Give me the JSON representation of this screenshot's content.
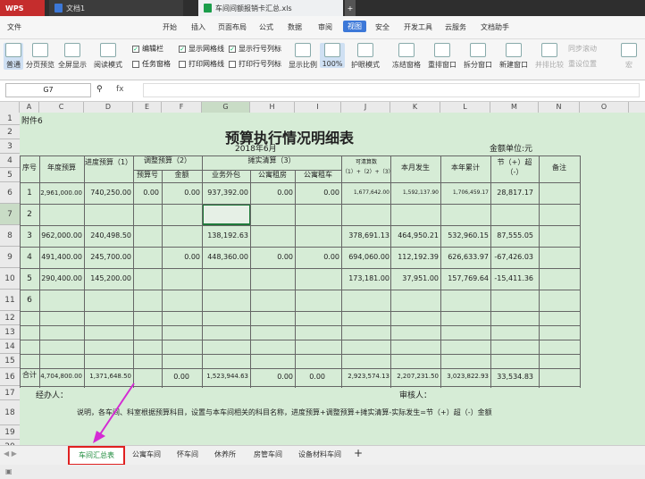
{
  "app": {
    "name": "WPS",
    "tab1": "文档1",
    "tab2": "车间间额报销卡汇总.xls",
    "add_tab": "+"
  },
  "menu": [
    "文件",
    "开始",
    "插入",
    "页面布局",
    "公式",
    "数据",
    "审阅",
    "视图",
    "安全",
    "开发工具",
    "云服务",
    "文档助手"
  ],
  "ribbon": {
    "normal": "普通",
    "page_break": "分页预览",
    "fullscreen": "全屏显示",
    "reading": "阅读模式",
    "edit_bar": "编辑栏",
    "show_grid": "显示网格线",
    "show_rowcol": "显示行号列标",
    "task_pane": "任务窗格",
    "print_grid": "打印网格线",
    "print_rowcol": "打印行号列标",
    "zoom": "显示比例",
    "zoom_value": "100%",
    "eye": "护眼模式",
    "freeze": "冻结窗格",
    "rearrange": "重排窗口",
    "split": "拆分窗口",
    "new_window": "新建窗口",
    "compare": "并排比较",
    "sync_scroll": "同步滚动",
    "reset_pos": "重设位置",
    "macro": "宏"
  },
  "formula": {
    "cell_ref": "G7",
    "fx": "fx",
    "content": ""
  },
  "columns": [
    "A",
    "C",
    "D",
    "E",
    "F",
    "G",
    "H",
    "I",
    "J",
    "K",
    "L",
    "M",
    "N",
    "O"
  ],
  "rows": [
    "1",
    "2",
    "3",
    "4",
    "5",
    "6",
    "7",
    "8",
    "9",
    "10",
    "11",
    "12",
    "13",
    "14",
    "15",
    "16",
    "17",
    "18",
    "19",
    "20"
  ],
  "sheet": {
    "attach": "附件6",
    "title": "预算执行情况明细表",
    "date": "2018年6月",
    "unit": "金额单位:元",
    "headers": {
      "seq": "序号",
      "annual": "年度预算",
      "progress": "进度预算（1）",
      "adjust": "调整预算（2）",
      "adj_no": "预算号",
      "adj_amt": "金额",
      "clear": "摊实清算（3）",
      "outsource": "业务外包",
      "apt_rent": "公寓租房",
      "apt_car": "公寓租车",
      "available": "可清算数（1）+（2）+（3）",
      "month": "本月发生",
      "year_total": "本年累计",
      "over": "节（+）超（-）",
      "remark": "备注"
    },
    "data": [
      {
        "seq": "1",
        "annual": "2,961,000.00",
        "progress": "740,250.00",
        "adj_no": "0.00",
        "adj_amt": "0.00",
        "outsource": "937,392.00",
        "apt_rent": "0.00",
        "apt_car": "0.00",
        "available": "1,677,642.00",
        "month": "1,592,137.90",
        "year": "1,706,459.17",
        "over": "28,817.17"
      },
      {
        "seq": "2",
        "annual": "",
        "progress": "",
        "adj_no": "",
        "adj_amt": "",
        "outsource": "",
        "apt_rent": "",
        "apt_car": "",
        "available": "",
        "month": "",
        "year": "",
        "over": ""
      },
      {
        "seq": "3",
        "annual": "962,000.00",
        "progress": "240,498.50",
        "adj_no": "",
        "adj_amt": "",
        "outsource": "138,192.63",
        "apt_rent": "",
        "apt_car": "",
        "available": "378,691.13",
        "month": "464,950.21",
        "year": "532,960.15",
        "over": "87,555.05"
      },
      {
        "seq": "4",
        "annual": "491,400.00",
        "progress": "245,700.00",
        "adj_no": "",
        "adj_amt": "0.00",
        "outsource": "448,360.00",
        "apt_rent": "0.00",
        "apt_car": "0.00",
        "available": "694,060.00",
        "month": "112,192.39",
        "year": "626,633.97",
        "over": "-67,426.03"
      },
      {
        "seq": "5",
        "annual": "290,400.00",
        "progress": "145,200.00",
        "adj_no": "",
        "adj_amt": "",
        "outsource": "",
        "apt_rent": "",
        "apt_car": "",
        "available": "173,181.00",
        "month": "37,951.00",
        "year": "157,769.64",
        "over": "-15,411.36"
      },
      {
        "seq": "6",
        "annual": "",
        "progress": "",
        "adj_no": "",
        "adj_amt": "",
        "outsource": "",
        "apt_rent": "",
        "apt_car": "",
        "available": "",
        "month": "",
        "year": "",
        "over": ""
      }
    ],
    "total": {
      "label": "合计",
      "annual": "4,704,800.00",
      "progress": "1,371,648.50",
      "adj_amt": "0.00",
      "outsource": "1,523,944.63",
      "apt_rent": "0.00",
      "apt_car": "0.00",
      "available": "2,923,574.13",
      "month": "2,207,231.50",
      "year": "3,023,822.93",
      "over": "33,534.83"
    },
    "manager": "经办人：",
    "reviewer": "审核人：",
    "note": "说明，各车间、科室根据预算科目，设置与本车间相关的科目名称，进度预算+调整预算+摊实清算-实际发生=节（+）超（-）金额"
  },
  "sheet_tabs": [
    "车间汇总表",
    "公寓车间",
    "怀车间",
    "休养所",
    "房管车间",
    "设备材料车间"
  ],
  "add_sheet": "+"
}
